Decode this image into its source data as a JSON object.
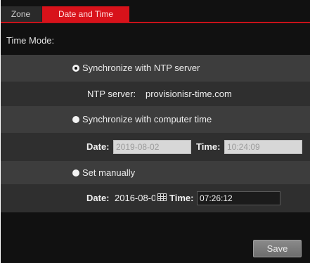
{
  "tabs": [
    {
      "label": "Zone",
      "active": false
    },
    {
      "label": "Date and Time",
      "active": true
    }
  ],
  "time_mode": {
    "title": "Time Mode:",
    "options": {
      "ntp": {
        "label": "Synchronize with NTP server",
        "selected": true
      },
      "computer": {
        "label": "Synchronize with computer time",
        "selected": false
      },
      "manual": {
        "label": "Set manually",
        "selected": false
      }
    }
  },
  "ntp": {
    "server_label": "NTP server:",
    "server_value": "provisionisr-time.com"
  },
  "computer_time": {
    "date_label": "Date:",
    "date_value": "2019-08-02",
    "time_label": "Time:",
    "time_value": "10:24:09"
  },
  "manual_time": {
    "date_label": "Date:",
    "date_value": "2016-08-02",
    "time_label": "Time:",
    "time_value": "07:26:12"
  },
  "buttons": {
    "save_label": "Save"
  },
  "colors": {
    "accent": "#d8121a",
    "panel_bg": "#111111",
    "band_light": "#3d3d3d",
    "band_dark": "#2f2f2f"
  },
  "icons": {
    "calendar": "calendar-icon",
    "radio": "radio-button-icon"
  }
}
